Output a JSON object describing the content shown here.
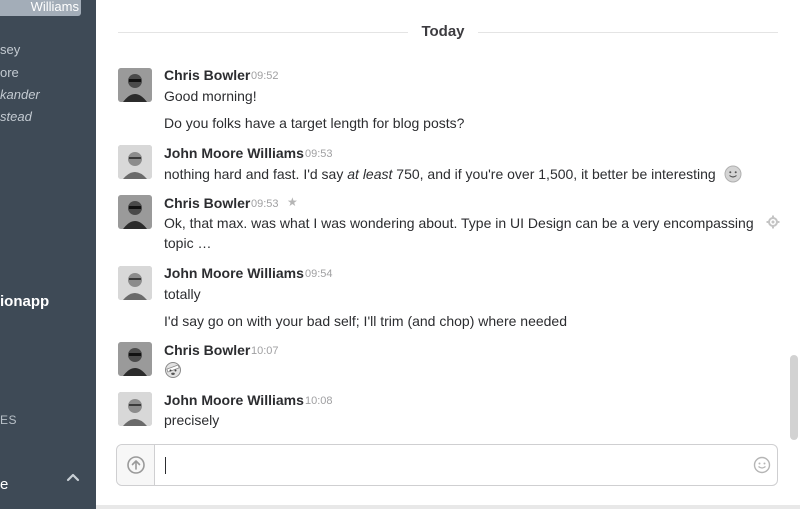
{
  "sidebar": {
    "active_item": "Williams",
    "items": [
      {
        "label": "sey",
        "italic": false
      },
      {
        "label": "ore",
        "italic": false
      },
      {
        "label": "kander",
        "italic": true
      },
      {
        "label": "stead",
        "italic": true
      }
    ],
    "team_name": "ionapp",
    "section_label": "ES",
    "bottom_label": "e"
  },
  "divider": {
    "label": "Today"
  },
  "messages": [
    {
      "author": "Chris Bowler",
      "time": "09:52",
      "lines": [
        "Good morning!",
        "Do you folks have a target length for blog posts?"
      ]
    },
    {
      "author": "John Moore Williams",
      "time": "09:53",
      "line_before_em": "nothing hard and fast. I'd say ",
      "line_em": "at least",
      "line_after_em": " 750, and if you're over 1,500, it better be interesting"
    },
    {
      "author": "Chris Bowler",
      "time": "09:53",
      "lines": [
        "Ok, that max. was what I was wondering about. Type in UI Design can be a very encompassing",
        "topic …"
      ]
    },
    {
      "author": "John Moore Williams",
      "time": "09:54",
      "lines": [
        "totally",
        "I'd say go on with your bad self; I'll trim (and chop) where needed"
      ]
    },
    {
      "author": "Chris Bowler",
      "time": "10:07",
      "emoji": "bandage-face-emoji"
    },
    {
      "author": "John Moore Williams",
      "time": "10:08",
      "lines": [
        "precisely"
      ]
    }
  ],
  "composer": {
    "value": "",
    "placeholder": ""
  },
  "colors": {
    "sidebar": "#3e4a56",
    "active_item": "#a3adb8",
    "text": "#2c2d30",
    "timestamp": "#a0a0a2"
  }
}
